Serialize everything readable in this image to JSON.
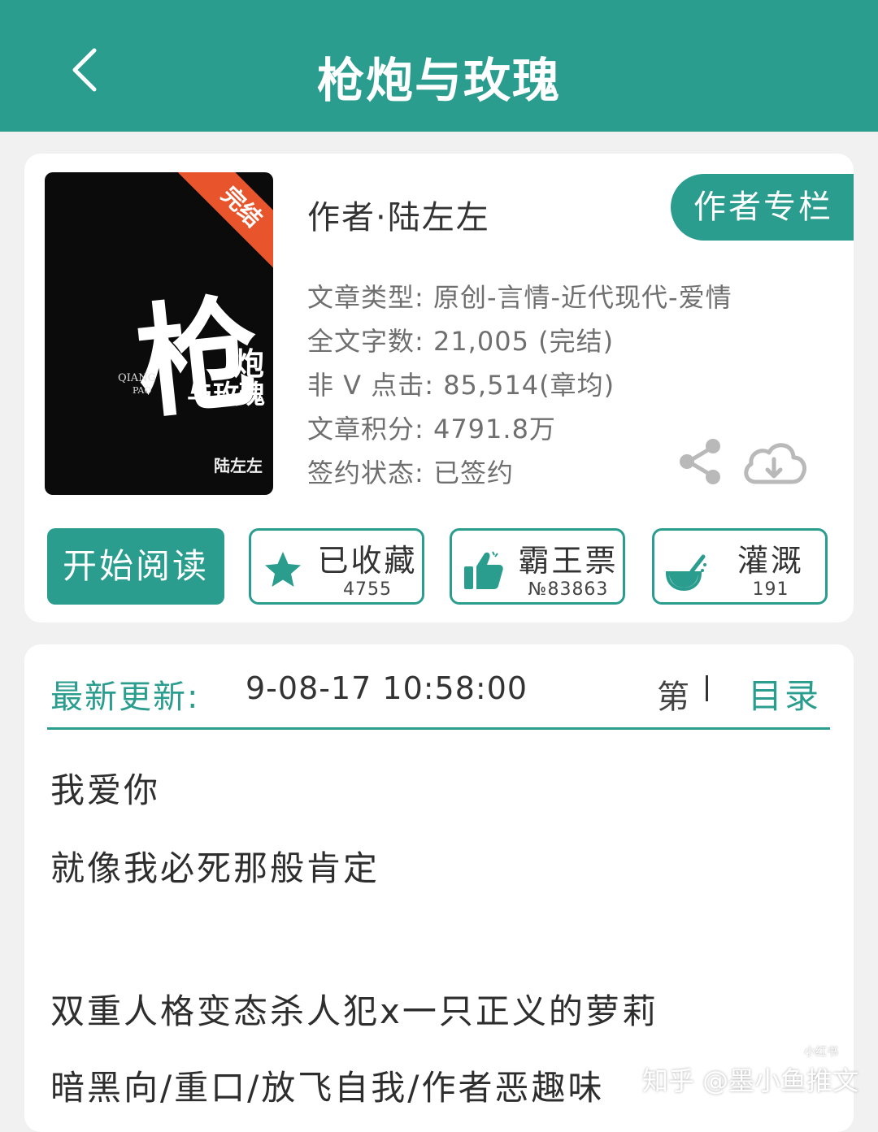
{
  "header": {
    "title": "枪炮与玫瑰"
  },
  "book": {
    "cover": {
      "badge": "完结",
      "big_char": "枪",
      "small_char": "炮",
      "small_line": "与玫瑰",
      "pinyin_1": "QIANG",
      "pinyin_2": "PAO",
      "author": "陆左左"
    },
    "author": "作者·陆左左",
    "author_column_button": "作者专栏",
    "meta": [
      "文章类型: 原创-言情-近代现代-爱情",
      "全文字数: 21,005 (完结)",
      "非 V 点击: 85,514(章均)",
      "文章积分: 4791.8万",
      "签约状态:  已签约"
    ]
  },
  "actions": {
    "read_label": "开始阅读",
    "buttons": [
      {
        "label": "已收藏",
        "count": "4755",
        "icon": "star-icon"
      },
      {
        "label": "霸王票",
        "count": "№83863",
        "icon": "thumbs-up-icon"
      },
      {
        "label": "灌溉",
        "count": "191",
        "icon": "watering-icon"
      }
    ]
  },
  "update": {
    "label": "最新更新:",
    "time": "9-08-17 10:58:00",
    "chapter_prefix": "第",
    "catalog_label": "目录"
  },
  "description": [
    "我爱你",
    "就像我必死那般肯定",
    "双重人格变态杀人犯x一只正义的萝莉",
    "暗黑向/重口/放飞自我/作者恶趣味"
  ],
  "watermark": {
    "text": "知乎 @墨小鱼推文",
    "badge": "小红书"
  },
  "colors": {
    "accent": "#2a9d8f",
    "ribbon": "#e8542c"
  }
}
